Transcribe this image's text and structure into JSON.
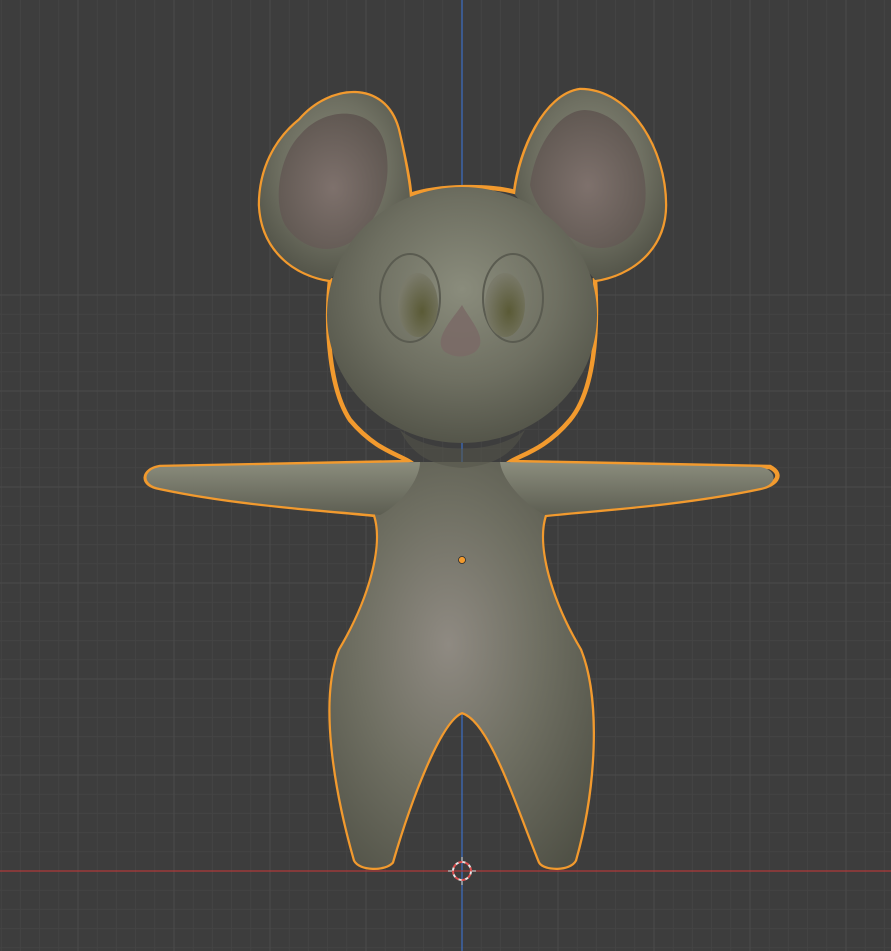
{
  "viewport": {
    "background_color": "#3d3d3d",
    "grid_minor_color": "#444444",
    "grid_major_color": "#4b4b4b",
    "x_axis_color": "#b03a3a",
    "z_axis_color": "#3c6fc4",
    "selection_outline_color": "#f29a2e",
    "cursor_color": "#e05050"
  },
  "scene": {
    "object": "mouse-character-mesh",
    "object_selected": true,
    "body_color": "#6e6f61",
    "inner_ear_color": "#776a66",
    "eye_color": "#5c5c44",
    "nose_color": "#7a6a66",
    "view": "front",
    "icons": [
      "3d-cursor-icon",
      "object-origin-icon"
    ]
  }
}
